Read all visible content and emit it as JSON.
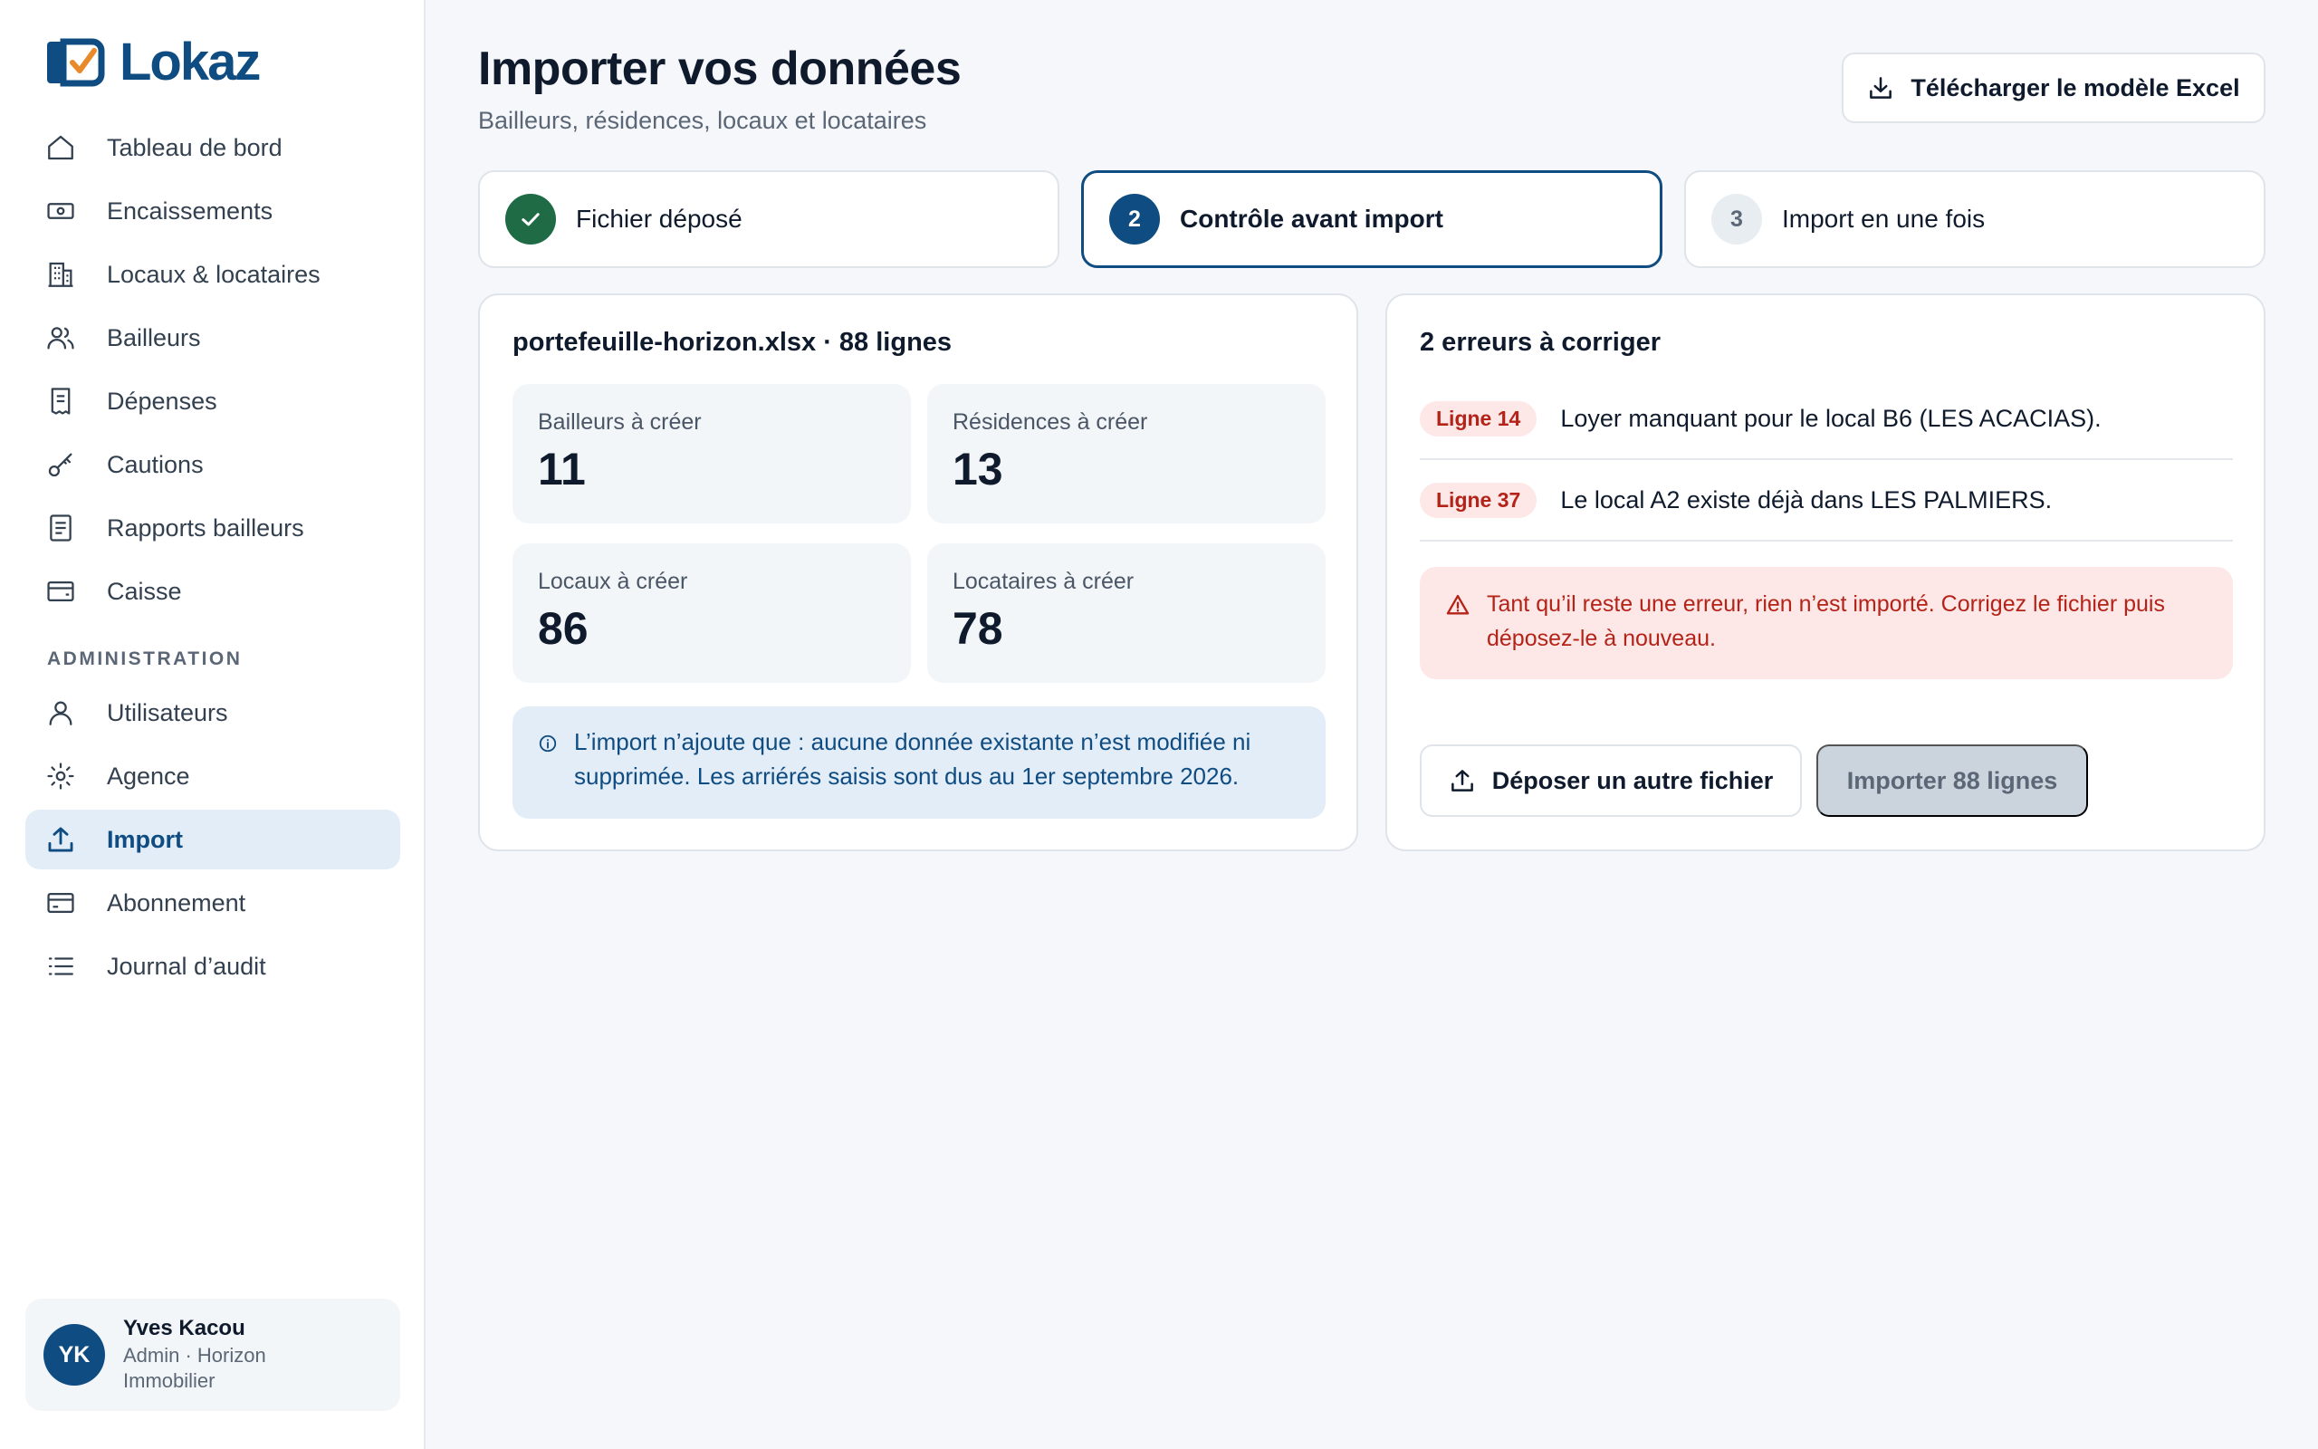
{
  "app": {
    "name": "Lokaz",
    "colors": {
      "brand": "#0f4c81",
      "success": "#1e6b46",
      "error": "#b42318",
      "accent_orange": "#e8892a"
    }
  },
  "sidebar": {
    "items": [
      {
        "label": "Tableau de bord",
        "icon": "home-icon"
      },
      {
        "label": "Encaissements",
        "icon": "cash-icon"
      },
      {
        "label": "Locaux & locataires",
        "icon": "building-icon"
      },
      {
        "label": "Bailleurs",
        "icon": "users-icon"
      },
      {
        "label": "Dépenses",
        "icon": "receipt-icon"
      },
      {
        "label": "Cautions",
        "icon": "key-icon"
      },
      {
        "label": "Rapports bailleurs",
        "icon": "report-icon"
      },
      {
        "label": "Caisse",
        "icon": "wallet-icon"
      }
    ],
    "admin_section": "ADMINISTRATION",
    "admin_items": [
      {
        "label": "Utilisateurs",
        "icon": "user-icon"
      },
      {
        "label": "Agence",
        "icon": "gear-icon"
      },
      {
        "label": "Import",
        "icon": "upload-icon",
        "active": true
      },
      {
        "label": "Abonnement",
        "icon": "credit-card-icon"
      },
      {
        "label": "Journal d’audit",
        "icon": "list-icon"
      }
    ],
    "user": {
      "initials": "YK",
      "name": "Yves Kacou",
      "role": "Admin · Horizon Immobilier"
    }
  },
  "header": {
    "title": "Importer vos données",
    "subtitle": "Bailleurs, résidences, locaux et locataires",
    "download_label": "Télécharger le modèle Excel"
  },
  "steps": [
    {
      "label": "Fichier déposé",
      "state": "done"
    },
    {
      "number": "2",
      "label": "Contrôle avant import",
      "state": "current"
    },
    {
      "number": "3",
      "label": "Import en une fois",
      "state": "todo"
    }
  ],
  "summary": {
    "title": "portefeuille-horizon.xlsx · 88 lignes",
    "stats": [
      {
        "label": "Bailleurs à créer",
        "value": "11"
      },
      {
        "label": "Résidences à créer",
        "value": "13"
      },
      {
        "label": "Locaux à créer",
        "value": "86"
      },
      {
        "label": "Locataires à créer",
        "value": "78"
      }
    ],
    "info": "L’import n’ajoute que : aucune donnée existante n’est modifiée ni supprimée. Les arriérés saisis sont dus au 1er septembre 2026."
  },
  "errors": {
    "title": "2 erreurs à corriger",
    "items": [
      {
        "badge": "Ligne 14",
        "text": "Loyer manquant pour le local B6 (LES ACACIAS)."
      },
      {
        "badge": "Ligne 37",
        "text": "Le local A2 existe déjà dans LES PALMIERS."
      }
    ],
    "alert": "Tant qu’il reste une erreur, rien n’est importé. Corrigez le fichier puis déposez-le à nouveau.",
    "upload_label": "Déposer un autre fichier",
    "import_label": "Importer 88 lignes"
  }
}
